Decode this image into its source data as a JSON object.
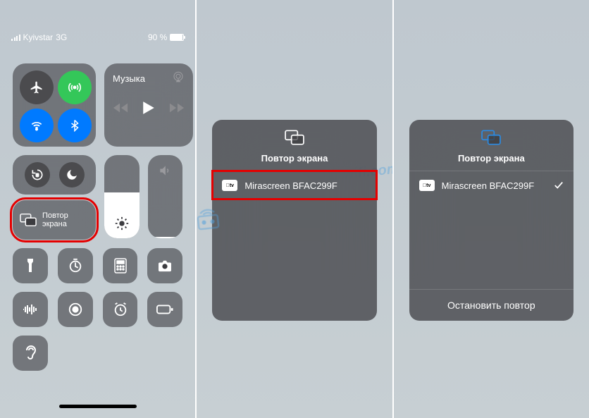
{
  "status": {
    "carrier": "Kyivstar",
    "network": "3G",
    "battery_pct": "90 %"
  },
  "music": {
    "label": "Музыка"
  },
  "tiles": {
    "screen_mirror_line1": "Повтор",
    "screen_mirror_line2": "экрана"
  },
  "brightness_pct": 55,
  "volume_pct": 2,
  "modal2": {
    "title": "Повтор экрана",
    "device": "Mirascreen BFAC299F"
  },
  "modal3": {
    "title": "Повтор экрана",
    "device": "Mirascreen BFAC299F",
    "stop": "Остановить повтор"
  },
  "watermark": "help-wifi.com"
}
